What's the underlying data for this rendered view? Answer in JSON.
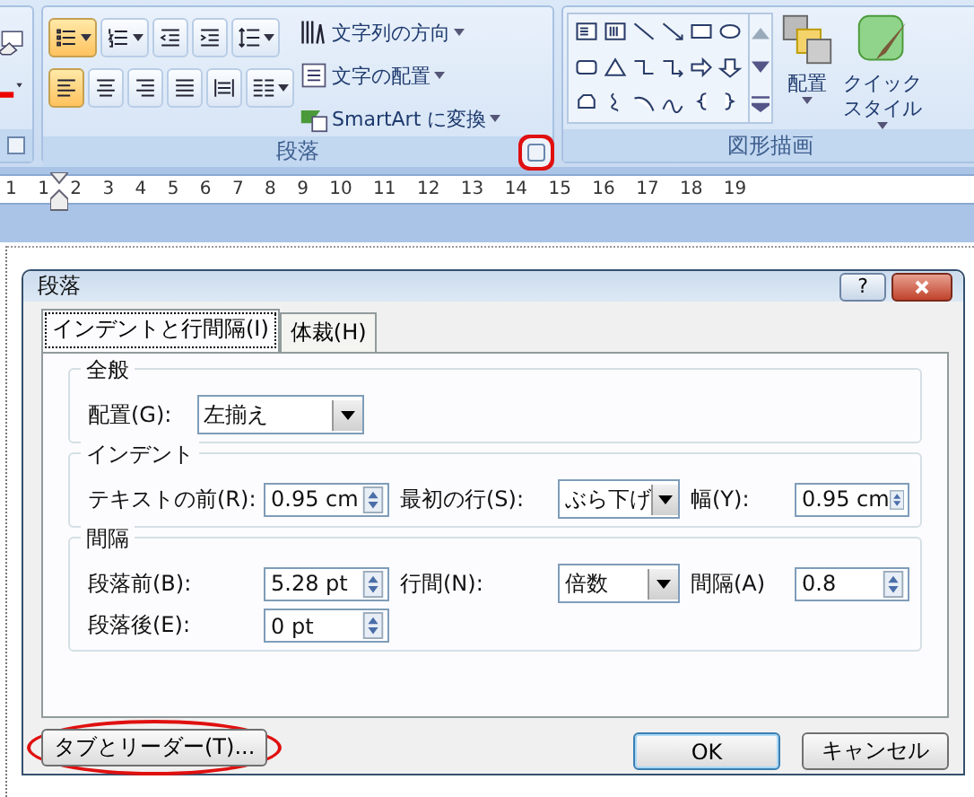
{
  "ribbon": {
    "left_group": {
      "launcher_circled": false
    },
    "paragraph_group": {
      "label": "段落",
      "launcher_circled": true,
      "row1": [
        {
          "kind": "bullets",
          "selected": true,
          "dropdown": true
        },
        {
          "kind": "numbering",
          "selected": false,
          "dropdown": true
        },
        {
          "kind": "outdent",
          "selected": false,
          "dropdown": false
        },
        {
          "kind": "indent",
          "selected": false,
          "dropdown": false
        },
        {
          "kind": "line_spacing",
          "selected": false,
          "dropdown": true
        }
      ],
      "row2": [
        {
          "kind": "align_left",
          "selected": true,
          "dropdown": false
        },
        {
          "kind": "align_center",
          "selected": false,
          "dropdown": false
        },
        {
          "kind": "align_right",
          "selected": false,
          "dropdown": false
        },
        {
          "kind": "justify",
          "selected": false,
          "dropdown": false
        },
        {
          "kind": "distribute",
          "selected": false,
          "dropdown": false
        },
        {
          "kind": "columns",
          "selected": false,
          "dropdown": true
        }
      ],
      "commands": [
        {
          "kind": "text_direction",
          "label": "文字列の方向"
        },
        {
          "kind": "align_text",
          "label": "文字の配置"
        },
        {
          "kind": "smartart",
          "label": "SmartArt に変換"
        }
      ]
    },
    "drawing_group": {
      "label": "図形描画",
      "large_buttons": [
        {
          "kind": "arrange",
          "label_lines": [
            "配置"
          ]
        },
        {
          "kind": "quick_styles",
          "label_lines": [
            "クイック",
            "スタイル"
          ]
        }
      ]
    }
  },
  "ruler": {
    "numbers": [
      "1",
      "1",
      "2",
      "3",
      "4",
      "5",
      "6",
      "7",
      "8",
      "9",
      "10",
      "11",
      "12",
      "13",
      "14",
      "15",
      "16",
      "17",
      "18",
      "19"
    ]
  },
  "dialog": {
    "title": "段落",
    "help_label": "?",
    "tabs": [
      {
        "label": "インデントと行間隔(I)",
        "selected": true
      },
      {
        "label": "体裁(H)",
        "selected": false
      }
    ],
    "general": {
      "title": "全般",
      "field": {
        "label": "配置(G):",
        "kind": "combo",
        "value": "左揃え"
      }
    },
    "sections": [
      {
        "title": "インデント",
        "fields": [
          {
            "label": "テキストの前(R):",
            "kind": "spin",
            "value": "0.95 cm"
          },
          {
            "label": "最初の行(S):",
            "kind": "combo",
            "value": "ぶら下げ"
          },
          {
            "label": "幅(Y):",
            "kind": "spin",
            "value": "0.95 cm"
          }
        ]
      },
      {
        "title": "間隔",
        "fields": [
          {
            "label": "段落前(B):",
            "kind": "spin",
            "value": "5.28 pt"
          },
          {
            "label": "行間(N):",
            "kind": "combo",
            "value": "倍数"
          },
          {
            "label": "間隔(A)",
            "kind": "spin",
            "value": "0.8"
          },
          {
            "label": "段落後(E):",
            "kind": "spin",
            "value": "0 pt"
          }
        ]
      }
    ],
    "buttons": [
      {
        "label": "タブとリーダー(T)...",
        "default": false,
        "circled": true
      },
      {
        "label": "OK",
        "default": true,
        "circled": false
      },
      {
        "label": "キャンセル",
        "default": false,
        "circled": false
      }
    ]
  }
}
